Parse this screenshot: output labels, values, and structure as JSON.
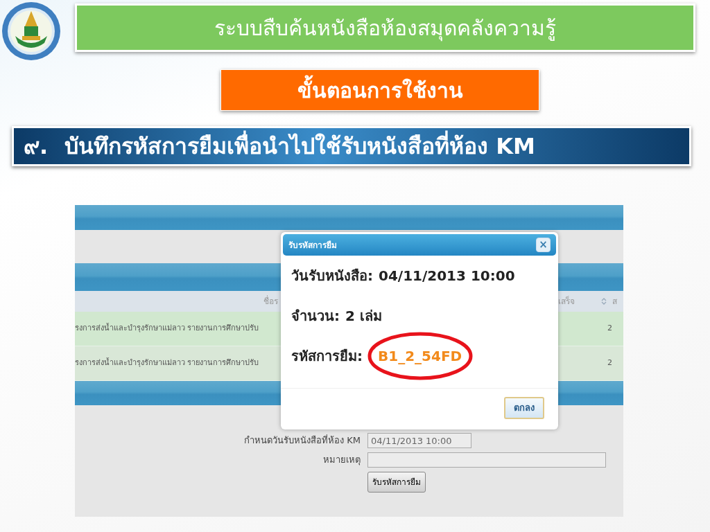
{
  "slide": {
    "title": "ระบบสืบค้นหนังสือห้องสมุดคลังความรู้",
    "subtitle": "ขั้นตอนการใช้งาน",
    "step_number": "๙.",
    "step_text": "บันทึกรหัสการยืมเพื่อนำไปใช้รับหนังสือที่ห้อง KM"
  },
  "screenshot": {
    "table": {
      "columns": [
        {
          "label": "ชื่อร",
          "sortable": false
        },
        {
          "label": "เสร็จ",
          "sortable": true
        },
        {
          "label": "ส",
          "sortable": false
        }
      ],
      "rows": [
        {
          "title": "รงการส่งน้ำและบำรุงรักษาแม่ลาว รายงานการศึกษาปรับ",
          "count": "2"
        },
        {
          "title": "รงการส่งน้ำและบำรุงรักษาแม่ลาว รายงานการศึกษาปรับ",
          "count": "2"
        }
      ]
    },
    "form": {
      "fields": [
        {
          "label": "กำหนดวันรับหนังสือที่ห้อง KM",
          "value": "04/11/2013 10:00"
        },
        {
          "label": "หมายเหตุ"
        }
      ],
      "button": "รับรหัสการยืม"
    },
    "dialog": {
      "title": "รับรหัสการยืม",
      "close": "×",
      "lines": [
        {
          "label": "วันรับหนังสือ:",
          "value": "04/11/2013 10:00",
          "highlighted": false
        },
        {
          "label": "จำนวน:",
          "value": "2 เล่ม",
          "highlighted": false
        },
        {
          "label": "รหัสการยืม:",
          "value": "B1_2_54FD",
          "highlighted": true
        }
      ],
      "button": "ตกลง"
    }
  }
}
